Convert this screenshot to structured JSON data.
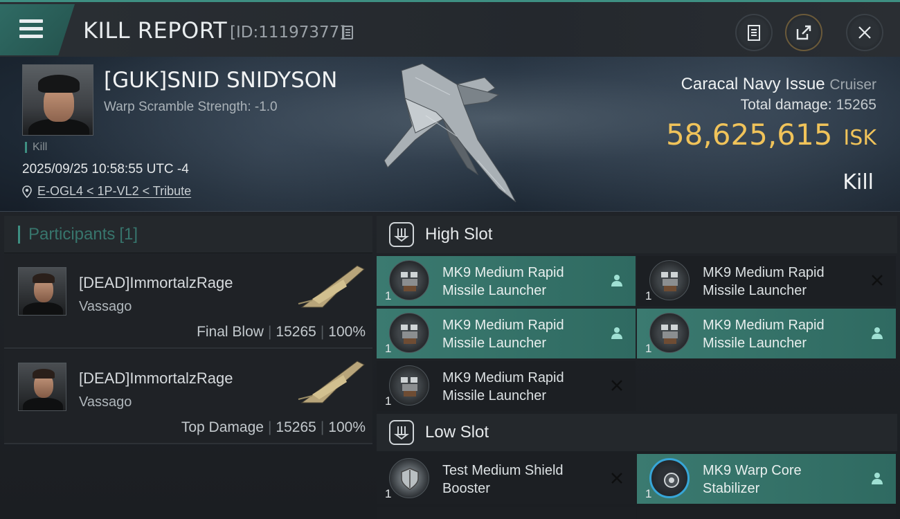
{
  "header": {
    "title": "KILL REPORT",
    "report_id": "[ID:11197377]"
  },
  "victim": {
    "name": "[GUK]SNID SNIDYSON",
    "warp_scramble": "Warp Scramble Strength: -1.0",
    "kill_tag": "Kill",
    "datetime": "2025/09/25 10:58:55 UTC -4",
    "location": "E-OGL4 < 1P-VL2 < Tribute",
    "ship_name": "Caracal Navy Issue",
    "ship_class": "Cruiser",
    "total_damage_label": "Total damage:",
    "total_damage": "15265",
    "isk_value": "58,625,615",
    "isk_unit": "ISK",
    "result": "Kill"
  },
  "participants": {
    "label": "Participants",
    "count": "[1]",
    "rows": [
      {
        "name": "[DEAD]ImmortalzRage",
        "ship": "Vassago",
        "role": "Final Blow",
        "damage": "15265",
        "percent": "100%"
      },
      {
        "name": "[DEAD]ImmortalzRage",
        "ship": "Vassago",
        "role": "Top Damage",
        "damage": "15265",
        "percent": "100%"
      }
    ]
  },
  "high_slot": {
    "label": "High Slot",
    "modules": [
      {
        "name": "MK9 Medium Rapid Missile Launcher",
        "qty": "1",
        "status": "dropped"
      },
      {
        "name": "MK9 Medium Rapid Missile Launcher",
        "qty": "1",
        "status": "destroyed"
      },
      {
        "name": "MK9 Medium Rapid Missile Launcher",
        "qty": "1",
        "status": "dropped"
      },
      {
        "name": "MK9 Medium Rapid Missile Launcher",
        "qty": "1",
        "status": "dropped"
      },
      {
        "name": "MK9 Medium Rapid Missile Launcher",
        "qty": "1",
        "status": "destroyed"
      }
    ]
  },
  "low_slot": {
    "label": "Low Slot",
    "modules": [
      {
        "name": "Test Medium Shield Booster",
        "qty": "1",
        "status": "destroyed"
      },
      {
        "name": "MK9 Warp Core Stabilizer",
        "qty": "1",
        "status": "dropped"
      }
    ]
  },
  "colors": {
    "accent": "#3e8f82",
    "isk": "#f0c35a",
    "dropped_bg": "#3b7a70"
  }
}
